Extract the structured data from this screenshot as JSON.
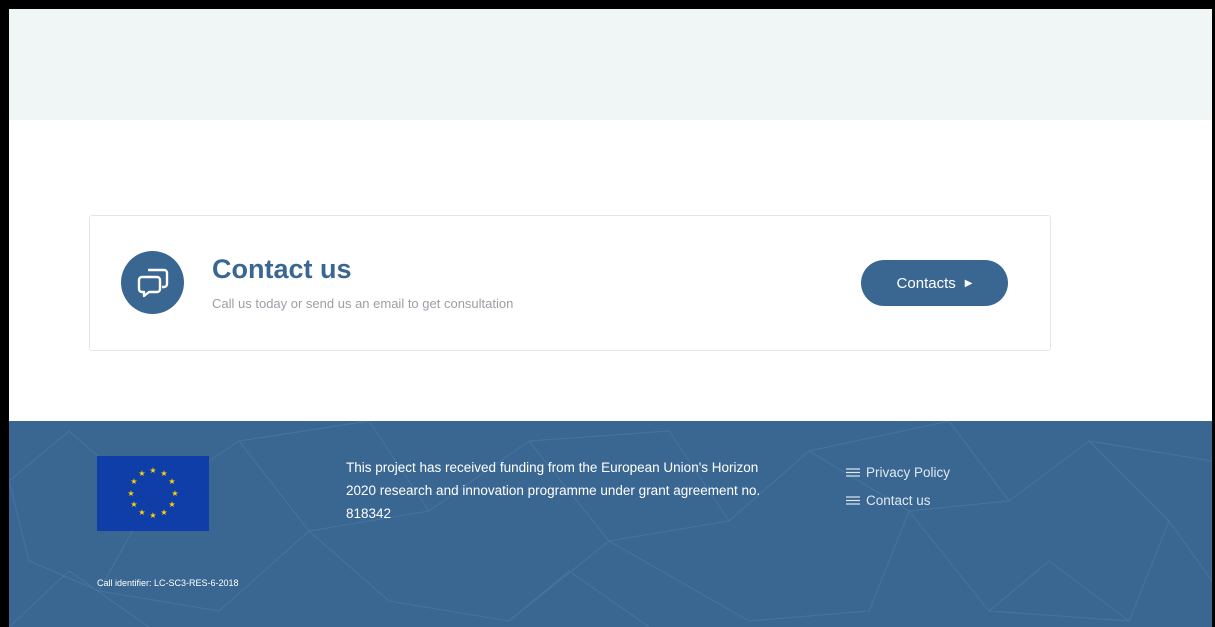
{
  "colors": {
    "brand": "#3a6792",
    "top_band": "#f0f5f5",
    "eu_blue": "#0f3ea8",
    "eu_star": "#ffd200"
  },
  "contact_section": {
    "icon": "chat-bubbles-icon",
    "title": "Contact us",
    "subtitle": "Call us today or send us an email to get consultation",
    "button_label": "Contacts",
    "button_icon": "caret-right-icon"
  },
  "footer": {
    "logo_icon": "eu-flag-icon",
    "funding_text": "This project has received funding from the European Union's Horizon 2020 research and innovation programme under grant agreement no. 818342",
    "links": [
      {
        "label": "Privacy Policy",
        "icon": "menu-lines-icon"
      },
      {
        "label": "Contact us",
        "icon": "menu-lines-icon"
      }
    ],
    "call_identifier": "Call identifier: LC-SC3-RES-6-2018"
  }
}
